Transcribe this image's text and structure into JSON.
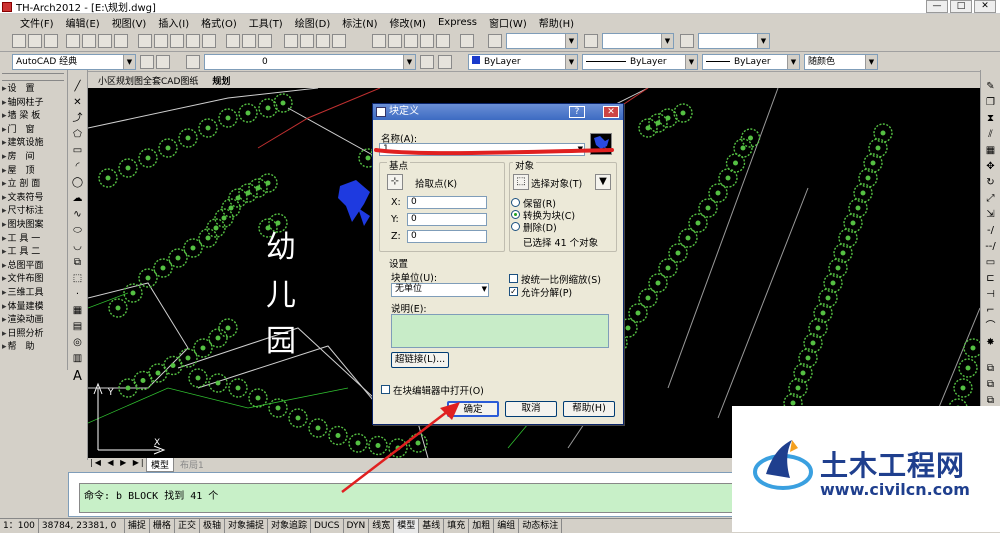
{
  "window": {
    "title": "TH-Arch2012 - [E:\\规划.dwg]",
    "controls": [
      "—",
      "□",
      "✕"
    ]
  },
  "menubar": [
    "文件(F)",
    "编辑(E)",
    "视图(V)",
    "插入(I)",
    "格式(O)",
    "工具(T)",
    "绘图(D)",
    "标注(N)",
    "修改(M)",
    "Express",
    "窗口(W)",
    "帮助(H)"
  ],
  "toolbar2": {
    "workspace": "AutoCAD 经典",
    "layer": "0",
    "color": "ByLayer",
    "linetype": "ByLayer",
    "lineweight": "ByLayer",
    "plotstyle": "随颜色"
  },
  "left_panel": {
    "items": [
      "设　置",
      "轴网柱子",
      "墙 梁 板",
      "门　窗",
      "建筑设施",
      "房　间",
      "屋　顶",
      "立 剖 面",
      "文表符号",
      "尺寸标注",
      "图块图案",
      "工 具 一",
      "工 具 二",
      "总图平面",
      "文件布图",
      "三维工具",
      "体量建模",
      "渲染动画",
      "日照分析",
      "帮　助"
    ]
  },
  "doc_tabs": [
    "小区规划图全套CAD图纸",
    "规划"
  ],
  "canvas": {
    "label_chars": [
      "幼",
      "儿",
      "园"
    ]
  },
  "model_tabs": [
    "模型",
    "布局1"
  ],
  "command": {
    "text": "命令: b BLOCK 找到 41 个"
  },
  "status": {
    "scale": "1：100",
    "coords": "38784, 23381, 0",
    "toggles": [
      "捕捉",
      "栅格",
      "正交",
      "极轴",
      "对象捕捉",
      "对象追踪",
      "DUCS",
      "DYN",
      "线宽",
      "模型",
      "基线",
      "填充",
      "加粗",
      "编组",
      "动态标注"
    ],
    "active": [
      "模型"
    ]
  },
  "dialog": {
    "title": "块定义",
    "help_btn": "?",
    "close_btn": "✕",
    "name_label": "名称(A):",
    "name_value": "1",
    "base_point": {
      "group": "基点",
      "pick_label": "拾取点(K)",
      "x_label": "X:",
      "x": "0",
      "y_label": "Y:",
      "y": "0",
      "z_label": "Z:",
      "z": "0"
    },
    "objects": {
      "group": "对象",
      "select_label": "选择对象(T)",
      "opt_retain": "保留(R)",
      "opt_convert": "转换为块(C)",
      "opt_delete": "删除(D)",
      "selected": "已选择 41 个对象"
    },
    "settings": {
      "group": "设置",
      "unit_label": "块单位(U):",
      "unit_value": "无单位",
      "scale_uniformly": "按统一比例缩放(S)",
      "allow_explode": "允许分解(P)",
      "desc_label": "说明(E):",
      "hyperlink": "超链接(L)..."
    },
    "open_in_editor": "在块编辑器中打开(O)",
    "ok": "确定",
    "cancel": "取消",
    "help": "帮助(H)"
  },
  "watermark": {
    "name": "土木工程网",
    "url": "www.civilcn.com"
  },
  "colors": {
    "accent": "#0a246a",
    "annotation": "#e02020",
    "canvas": "#000000",
    "trees": "#55c043",
    "watermark": "#1f3f8e"
  }
}
